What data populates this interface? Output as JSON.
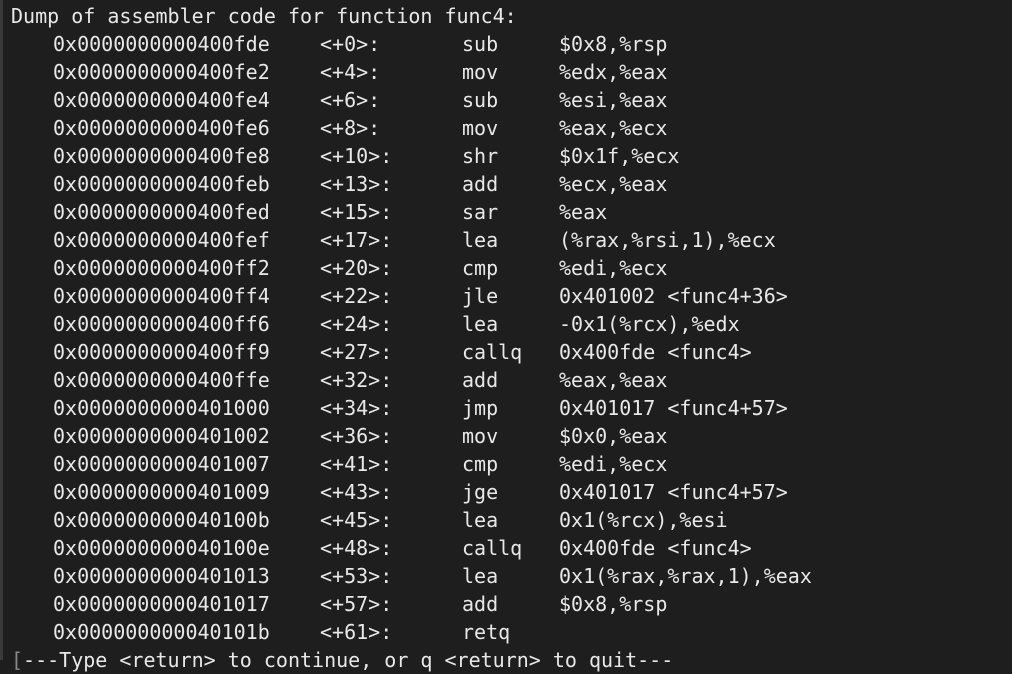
{
  "header": "Dump of assembler code for function func4:",
  "instructions": [
    {
      "addr": "0x0000000000400fde",
      "off": "<+0>:",
      "mn": "sub",
      "op": "$0x8,%rsp"
    },
    {
      "addr": "0x0000000000400fe2",
      "off": "<+4>:",
      "mn": "mov",
      "op": "%edx,%eax"
    },
    {
      "addr": "0x0000000000400fe4",
      "off": "<+6>:",
      "mn": "sub",
      "op": "%esi,%eax"
    },
    {
      "addr": "0x0000000000400fe6",
      "off": "<+8>:",
      "mn": "mov",
      "op": "%eax,%ecx"
    },
    {
      "addr": "0x0000000000400fe8",
      "off": "<+10>:",
      "mn": "shr",
      "op": "$0x1f,%ecx"
    },
    {
      "addr": "0x0000000000400feb",
      "off": "<+13>:",
      "mn": "add",
      "op": "%ecx,%eax"
    },
    {
      "addr": "0x0000000000400fed",
      "off": "<+15>:",
      "mn": "sar",
      "op": "%eax"
    },
    {
      "addr": "0x0000000000400fef",
      "off": "<+17>:",
      "mn": "lea",
      "op": "(%rax,%rsi,1),%ecx"
    },
    {
      "addr": "0x0000000000400ff2",
      "off": "<+20>:",
      "mn": "cmp",
      "op": "%edi,%ecx"
    },
    {
      "addr": "0x0000000000400ff4",
      "off": "<+22>:",
      "mn": "jle",
      "op": "0x401002 <func4+36>"
    },
    {
      "addr": "0x0000000000400ff6",
      "off": "<+24>:",
      "mn": "lea",
      "op": "-0x1(%rcx),%edx"
    },
    {
      "addr": "0x0000000000400ff9",
      "off": "<+27>:",
      "mn": "callq",
      "op": "0x400fde <func4>"
    },
    {
      "addr": "0x0000000000400ffe",
      "off": "<+32>:",
      "mn": "add",
      "op": "%eax,%eax"
    },
    {
      "addr": "0x0000000000401000",
      "off": "<+34>:",
      "mn": "jmp",
      "op": "0x401017 <func4+57>"
    },
    {
      "addr": "0x0000000000401002",
      "off": "<+36>:",
      "mn": "mov",
      "op": "$0x0,%eax"
    },
    {
      "addr": "0x0000000000401007",
      "off": "<+41>:",
      "mn": "cmp",
      "op": "%edi,%ecx"
    },
    {
      "addr": "0x0000000000401009",
      "off": "<+43>:",
      "mn": "jge",
      "op": "0x401017 <func4+57>"
    },
    {
      "addr": "0x000000000040100b",
      "off": "<+45>:",
      "mn": "lea",
      "op": "0x1(%rcx),%esi"
    },
    {
      "addr": "0x000000000040100e",
      "off": "<+48>:",
      "mn": "callq",
      "op": "0x400fde <func4>"
    },
    {
      "addr": "0x0000000000401013",
      "off": "<+53>:",
      "mn": "lea",
      "op": "0x1(%rax,%rax,1),%eax"
    },
    {
      "addr": "0x0000000000401017",
      "off": "<+57>:",
      "mn": "add",
      "op": "$0x8,%rsp"
    },
    {
      "addr": "0x000000000040101b",
      "off": "<+61>:",
      "mn": "retq",
      "op": ""
    }
  ],
  "pager": {
    "bracket": "[",
    "text": "---Type <return> to continue, or q <return> to quit---"
  }
}
